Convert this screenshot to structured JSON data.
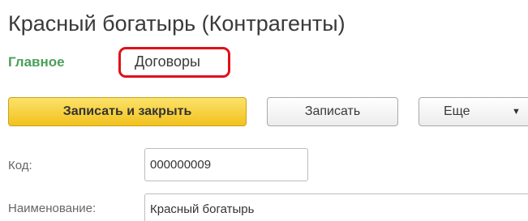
{
  "form": {
    "title": "Красный богатырь (Контрагенты)"
  },
  "tabs": {
    "main": "Главное",
    "contracts": "Договоры"
  },
  "toolbar": {
    "save_close_label": "Записать и закрыть",
    "save_label": "Записать",
    "more_label": "Еще",
    "more_arrow": "▼"
  },
  "fields": {
    "code_label": "Код:",
    "code_value": "000000009",
    "name_label": "Наименование:",
    "name_value": "Красный богатырь"
  },
  "colors": {
    "accent_green": "#4aa05a",
    "primary_button": "#f2c21e",
    "highlight": "#e0101a"
  }
}
